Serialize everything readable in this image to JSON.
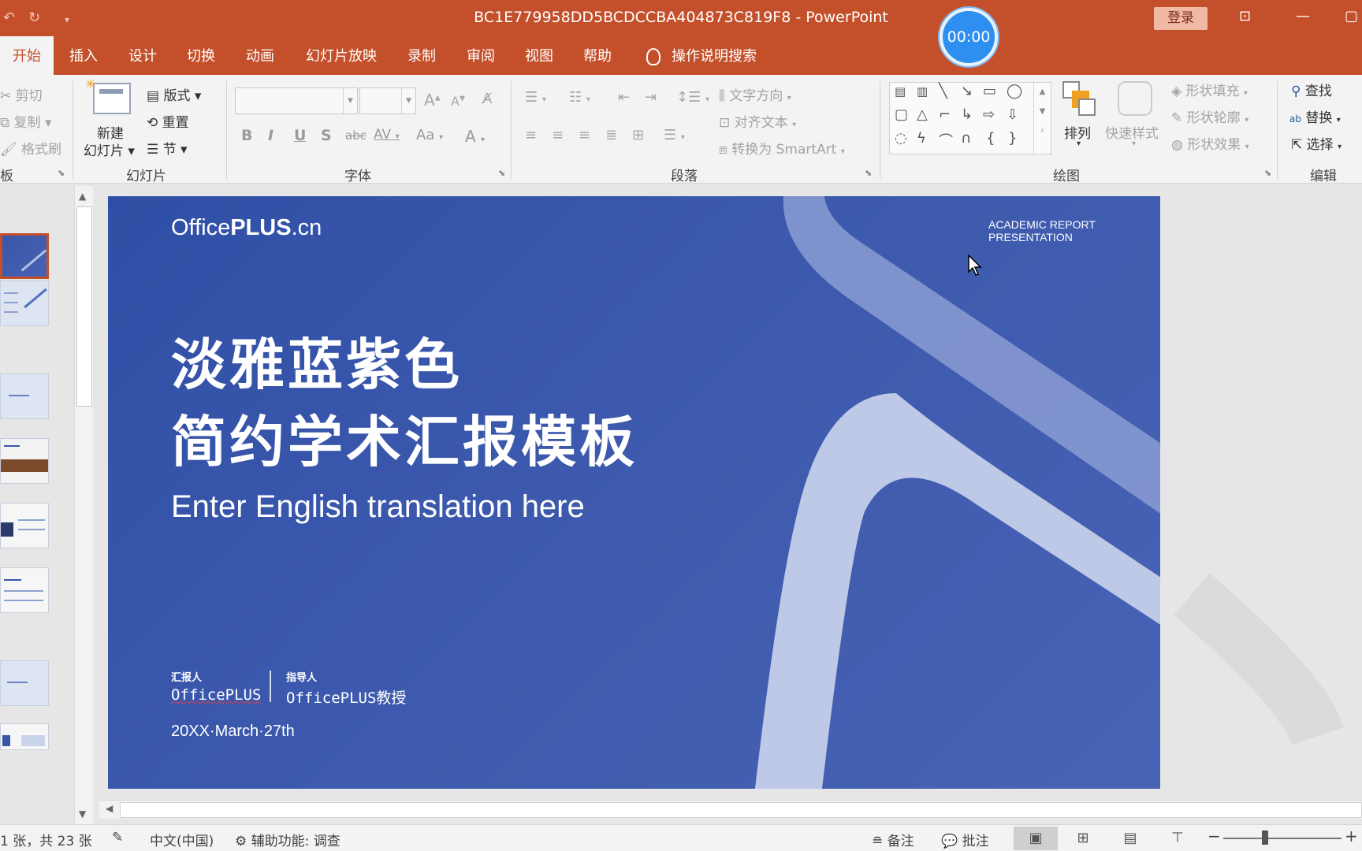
{
  "window": {
    "title": "BC1E779958DD5BCDCCBA404873C819F8  -  PowerPoint",
    "timer": "00:00",
    "login_label": "登录"
  },
  "tabs": [
    "开始",
    "插入",
    "设计",
    "切换",
    "动画",
    "幻灯片放映",
    "录制",
    "审阅",
    "视图",
    "帮助"
  ],
  "tell_me": "操作说明搜索",
  "ribbon": {
    "clipboard": {
      "cut": "剪切",
      "copy": "复制",
      "format_painter": "格式刷",
      "group": "板"
    },
    "slides": {
      "new_slide_line1": "新建",
      "new_slide_line2": "幻灯片",
      "layout": "版式",
      "reset": "重置",
      "section": "节",
      "group": "幻灯片"
    },
    "font": {
      "group": "字体",
      "bold": "B",
      "italic": "I",
      "underline": "U",
      "shadow": "S",
      "strike": "abc",
      "spacing": "AV",
      "case": "Aa",
      "color": "A",
      "grow": "A",
      "shrink": "A"
    },
    "paragraph": {
      "group": "段落",
      "text_direction": "文字方向",
      "align_text": "对齐文本",
      "smartart": "转换为 SmartArt"
    },
    "drawing": {
      "group": "绘图",
      "arrange": "排列",
      "quick_styles": "快速样式",
      "shape_fill": "形状填充",
      "shape_outline": "形状轮廓",
      "shape_effects": "形状效果"
    },
    "editing": {
      "group": "编辑",
      "find": "查找",
      "replace": "替换",
      "select": "选择"
    }
  },
  "slide": {
    "logo_regular": "Office",
    "logo_bold": "PLUS",
    "logo_suffix": ".cn",
    "academic_line1": "ACADEMIC REPORT",
    "academic_line2": "PRESENTATION",
    "title_line1": "淡雅蓝紫色",
    "title_line2": "简约学术汇报模板",
    "subtitle": "Enter English translation here",
    "reporter_label": "汇报人",
    "reporter_name": "OfficePLUS",
    "advisor_label": "指导人",
    "advisor_name": "OfficePLUS教授",
    "date": "20XX·March·27th"
  },
  "status": {
    "slide_count": "1 张，共 23 张",
    "language": "中文(中国)",
    "accessibility": "辅助功能: 调查",
    "notes": "备注",
    "comments": "批注"
  },
  "colors": {
    "accent": "#c4502b",
    "slide_bg": "#3c59ad"
  }
}
